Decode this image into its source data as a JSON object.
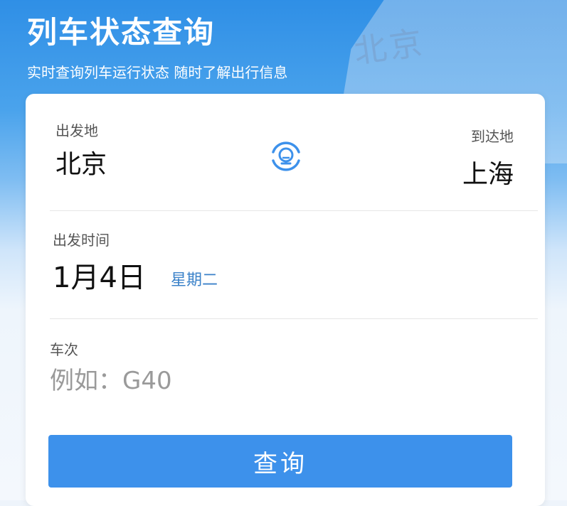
{
  "header": {
    "title": "列车状态查询",
    "subtitle": "实时查询列车运行状态 随时了解出行信息",
    "background_sign": "北京"
  },
  "route": {
    "from_label": "出发地",
    "from_city": "北京",
    "to_label": "到达地",
    "to_city": "上海",
    "swap_icon": "railway-logo-swap-icon"
  },
  "date": {
    "label": "出发时间",
    "value": "1月4日",
    "weekday": "星期二"
  },
  "train": {
    "label": "车次",
    "placeholder": "例如：G40"
  },
  "actions": {
    "query_label": "查询"
  },
  "colors": {
    "primary": "#3d91eb",
    "weekday": "#3b82c9",
    "header_blue": "#2f8fe6"
  }
}
